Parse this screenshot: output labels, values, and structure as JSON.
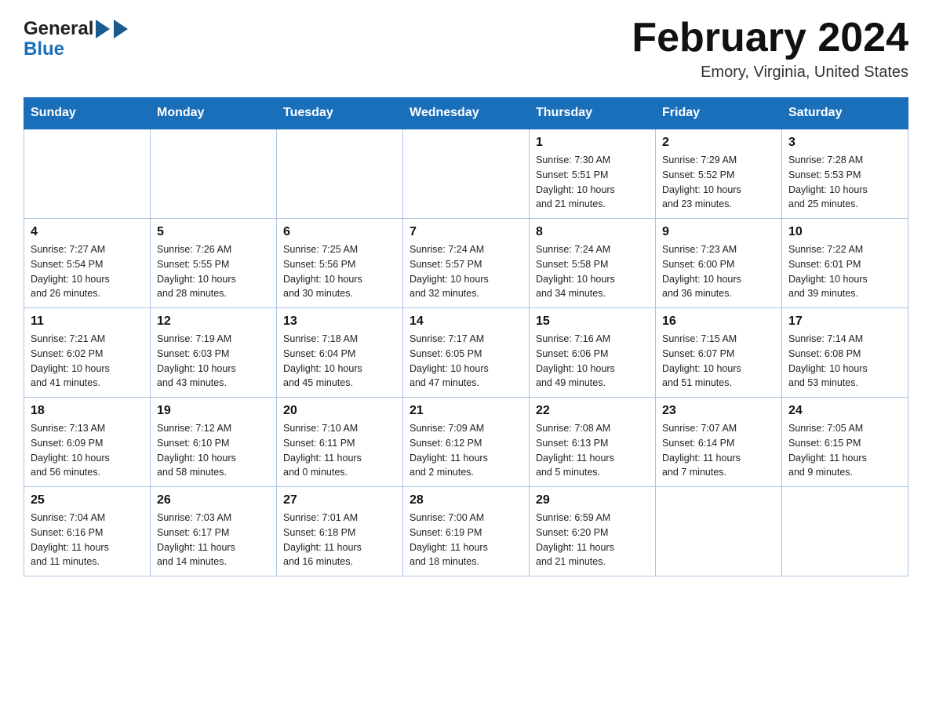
{
  "header": {
    "logo_general": "General",
    "logo_blue": "Blue",
    "title": "February 2024",
    "location": "Emory, Virginia, United States"
  },
  "weekdays": [
    "Sunday",
    "Monday",
    "Tuesday",
    "Wednesday",
    "Thursday",
    "Friday",
    "Saturday"
  ],
  "weeks": [
    [
      {
        "day": "",
        "info": ""
      },
      {
        "day": "",
        "info": ""
      },
      {
        "day": "",
        "info": ""
      },
      {
        "day": "",
        "info": ""
      },
      {
        "day": "1",
        "info": "Sunrise: 7:30 AM\nSunset: 5:51 PM\nDaylight: 10 hours\nand 21 minutes."
      },
      {
        "day": "2",
        "info": "Sunrise: 7:29 AM\nSunset: 5:52 PM\nDaylight: 10 hours\nand 23 minutes."
      },
      {
        "day": "3",
        "info": "Sunrise: 7:28 AM\nSunset: 5:53 PM\nDaylight: 10 hours\nand 25 minutes."
      }
    ],
    [
      {
        "day": "4",
        "info": "Sunrise: 7:27 AM\nSunset: 5:54 PM\nDaylight: 10 hours\nand 26 minutes."
      },
      {
        "day": "5",
        "info": "Sunrise: 7:26 AM\nSunset: 5:55 PM\nDaylight: 10 hours\nand 28 minutes."
      },
      {
        "day": "6",
        "info": "Sunrise: 7:25 AM\nSunset: 5:56 PM\nDaylight: 10 hours\nand 30 minutes."
      },
      {
        "day": "7",
        "info": "Sunrise: 7:24 AM\nSunset: 5:57 PM\nDaylight: 10 hours\nand 32 minutes."
      },
      {
        "day": "8",
        "info": "Sunrise: 7:24 AM\nSunset: 5:58 PM\nDaylight: 10 hours\nand 34 minutes."
      },
      {
        "day": "9",
        "info": "Sunrise: 7:23 AM\nSunset: 6:00 PM\nDaylight: 10 hours\nand 36 minutes."
      },
      {
        "day": "10",
        "info": "Sunrise: 7:22 AM\nSunset: 6:01 PM\nDaylight: 10 hours\nand 39 minutes."
      }
    ],
    [
      {
        "day": "11",
        "info": "Sunrise: 7:21 AM\nSunset: 6:02 PM\nDaylight: 10 hours\nand 41 minutes."
      },
      {
        "day": "12",
        "info": "Sunrise: 7:19 AM\nSunset: 6:03 PM\nDaylight: 10 hours\nand 43 minutes."
      },
      {
        "day": "13",
        "info": "Sunrise: 7:18 AM\nSunset: 6:04 PM\nDaylight: 10 hours\nand 45 minutes."
      },
      {
        "day": "14",
        "info": "Sunrise: 7:17 AM\nSunset: 6:05 PM\nDaylight: 10 hours\nand 47 minutes."
      },
      {
        "day": "15",
        "info": "Sunrise: 7:16 AM\nSunset: 6:06 PM\nDaylight: 10 hours\nand 49 minutes."
      },
      {
        "day": "16",
        "info": "Sunrise: 7:15 AM\nSunset: 6:07 PM\nDaylight: 10 hours\nand 51 minutes."
      },
      {
        "day": "17",
        "info": "Sunrise: 7:14 AM\nSunset: 6:08 PM\nDaylight: 10 hours\nand 53 minutes."
      }
    ],
    [
      {
        "day": "18",
        "info": "Sunrise: 7:13 AM\nSunset: 6:09 PM\nDaylight: 10 hours\nand 56 minutes."
      },
      {
        "day": "19",
        "info": "Sunrise: 7:12 AM\nSunset: 6:10 PM\nDaylight: 10 hours\nand 58 minutes."
      },
      {
        "day": "20",
        "info": "Sunrise: 7:10 AM\nSunset: 6:11 PM\nDaylight: 11 hours\nand 0 minutes."
      },
      {
        "day": "21",
        "info": "Sunrise: 7:09 AM\nSunset: 6:12 PM\nDaylight: 11 hours\nand 2 minutes."
      },
      {
        "day": "22",
        "info": "Sunrise: 7:08 AM\nSunset: 6:13 PM\nDaylight: 11 hours\nand 5 minutes."
      },
      {
        "day": "23",
        "info": "Sunrise: 7:07 AM\nSunset: 6:14 PM\nDaylight: 11 hours\nand 7 minutes."
      },
      {
        "day": "24",
        "info": "Sunrise: 7:05 AM\nSunset: 6:15 PM\nDaylight: 11 hours\nand 9 minutes."
      }
    ],
    [
      {
        "day": "25",
        "info": "Sunrise: 7:04 AM\nSunset: 6:16 PM\nDaylight: 11 hours\nand 11 minutes."
      },
      {
        "day": "26",
        "info": "Sunrise: 7:03 AM\nSunset: 6:17 PM\nDaylight: 11 hours\nand 14 minutes."
      },
      {
        "day": "27",
        "info": "Sunrise: 7:01 AM\nSunset: 6:18 PM\nDaylight: 11 hours\nand 16 minutes."
      },
      {
        "day": "28",
        "info": "Sunrise: 7:00 AM\nSunset: 6:19 PM\nDaylight: 11 hours\nand 18 minutes."
      },
      {
        "day": "29",
        "info": "Sunrise: 6:59 AM\nSunset: 6:20 PM\nDaylight: 11 hours\nand 21 minutes."
      },
      {
        "day": "",
        "info": ""
      },
      {
        "day": "",
        "info": ""
      }
    ]
  ]
}
